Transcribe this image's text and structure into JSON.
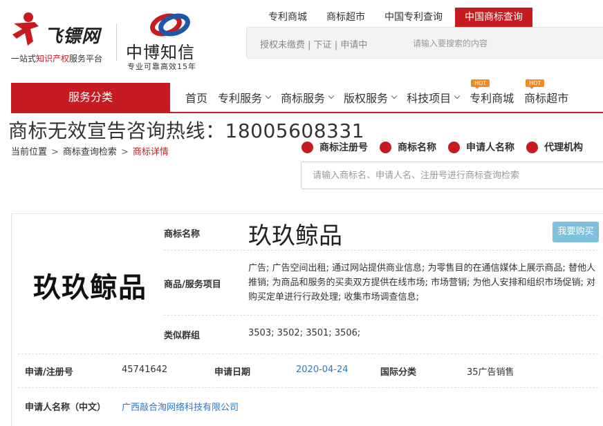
{
  "header": {
    "logo1": {
      "name": "飞镖网",
      "slogan_pre": "一站式",
      "slogan_hl": "知识产权",
      "slogan_post": "服务平台"
    },
    "logo2": {
      "name": "中博知信",
      "slogan": "专业可靠高效15年"
    },
    "top_tabs": [
      "专利商城",
      "商标超市",
      "中国专利查询",
      "中国商标查询"
    ],
    "status_text": "授权未缴费 | 下证 | 申请中",
    "search_placeholder": "请输入要搜索的内容"
  },
  "nav": {
    "category_label": "服务分类",
    "items": [
      {
        "label": "首页",
        "has_menu": false,
        "hot": false
      },
      {
        "label": "专利服务",
        "has_menu": true,
        "hot": false
      },
      {
        "label": "商标服务",
        "has_menu": true,
        "hot": false
      },
      {
        "label": "版权服务",
        "has_menu": true,
        "hot": false
      },
      {
        "label": "科技项目",
        "has_menu": true,
        "hot": false
      },
      {
        "label": "专利商城",
        "has_menu": false,
        "hot": true
      },
      {
        "label": "商标超市",
        "has_menu": false,
        "hot": true
      }
    ],
    "hot_badge": "HOT"
  },
  "hotline": "商标无效宣告咨询热线：18005608331",
  "breadcrumb": [
    "当前位置",
    "商标查询检索",
    "商标详情"
  ],
  "breadcrumb_sep": ">",
  "query_tabs": [
    "商标注册号",
    "商标名称",
    "申请人名称",
    "代理机构"
  ],
  "query_search_placeholder": "请输入商标名、申请人名、注册号进行商标查询检索",
  "trademark": {
    "image_text": "玖玖鲸品",
    "name_label": "商标名称",
    "name": "玖玖鲸品",
    "buy_label": "我要购买",
    "goods_label": "商品/服务项目",
    "goods": "广告; 广告空间出租; 通过网站提供商业信息; 为零售目的在通信媒体上展示商品; 替他人推销; 为商品和服务的买卖双方提供在线市场; 市场营销; 为他人安排和组织市场促销; 对购买定单进行行政处理; 收集市场调查信息;",
    "similar_label": "类似群组",
    "similar": "3503; 3502; 3501; 3506;",
    "reg_label": "申请/注册号",
    "reg_no": "45741642",
    "date_label": "申请日期",
    "date": "2020-04-24",
    "class_label": "国际分类",
    "class": "35广告销售",
    "applicant_label": "申请人名称（中文）",
    "applicant": "广西敲合淘网络科技有限公司"
  },
  "colors": {
    "brand_red": "#c61c21",
    "hot_orange": "#f08a24",
    "buy_blue": "#7fc1dc",
    "link_blue": "#2f78c4"
  }
}
